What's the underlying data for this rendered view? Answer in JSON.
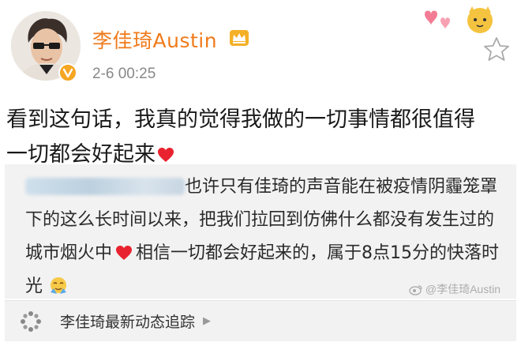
{
  "header": {
    "username": "李佳琦Austin",
    "timestamp": "2-6 00:25"
  },
  "post": {
    "line1": "看到这句话，我真的觉得我做的一切事情都很值得",
    "line2": "一切都会好起来"
  },
  "repost": {
    "text_part1": "也许只有佳琦的声音能在被疫情阴霾笼罩下的这么长时间以来，把我们拉回到仿佛什么都没有发生过的城市烟火中",
    "text_part2": "相信一切都会好起来的，属于8点15分的快落时光",
    "watermark": "@李佳琦Austin"
  },
  "topic": {
    "label": "李佳琦最新动态追踪"
  },
  "colors": {
    "username": "#f07a1a",
    "heart": "#e8232f",
    "repost_bg": "#f2f2f2"
  },
  "icons": [
    "avatar",
    "verified-badge-icon",
    "crown-vip-icon",
    "heart-icon",
    "star-icon",
    "emoji-icon",
    "weibo-logo-icon",
    "topic-dots-icon",
    "chevron-right-icon"
  ]
}
